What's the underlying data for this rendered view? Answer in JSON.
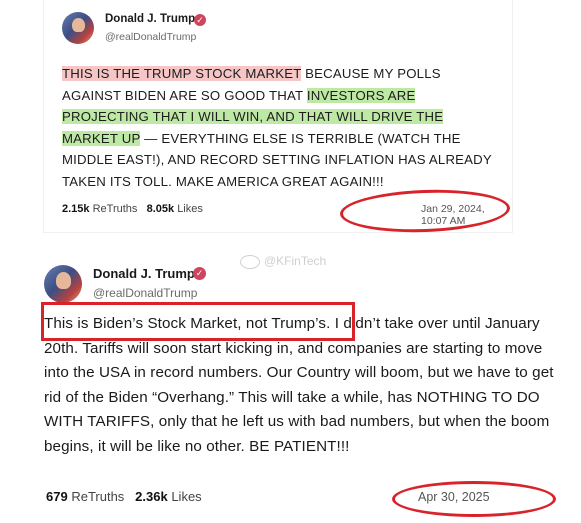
{
  "post1": {
    "name": "Donald J. Trump",
    "handle": "@realDonaldTrump",
    "text": {
      "part1": "THIS IS THE TRUMP STOCK MARKET",
      "part2": " BECAUSE MY POLLS AGAINST BIDEN ARE SO GOOD THAT ",
      "part3": "INVESTORS ARE PROJECTING THAT I WILL WIN, AND THAT WILL DRIVE THE MARKET UP",
      "part4": " — EVERYTHING ELSE IS TERRIBLE (WATCH THE MIDDLE EAST!), AND RECORD SETTING INFLATION HAS ALREADY TAKEN ITS TOLL. MAKE AMERICA GREAT AGAIN!!!"
    },
    "retruths_count": "2.15k",
    "retruths_label": "ReTruths",
    "likes_count": "8.05k",
    "likes_label": "Likes",
    "date": "Jan 29, 2024, 10:07 AM"
  },
  "watermark": "@KFinTech",
  "post2": {
    "name": "Donald J. Trump",
    "handle": "@realDonaldTrump",
    "text": {
      "boxed": "This is Biden’s Stock Market, not Trump’s.",
      "rest": " I didn’t take over until January 20th. Tariffs will soon start kicking in, and companies are starting to move into the USA in record numbers. Our Country will boom, but we have to get rid of the Biden “Overhang.” This will take a while, has NOTHING TO DO WITH TARIFFS, only that he left us with bad numbers, but when the boom begins, it will be like no other. BE PATIENT!!!"
    },
    "retruths_count": "679",
    "retruths_label": "ReTruths",
    "likes_count": "2.36k",
    "likes_label": "Likes",
    "date": "Apr 30, 2025"
  },
  "colors": {
    "annotation_red": "#d8232a",
    "highlight_red": "#f6c6c6",
    "highlight_green": "#bde9a5",
    "verified_badge": "#d0455e"
  },
  "icons": [
    "verified-badge-icon",
    "avatar"
  ]
}
